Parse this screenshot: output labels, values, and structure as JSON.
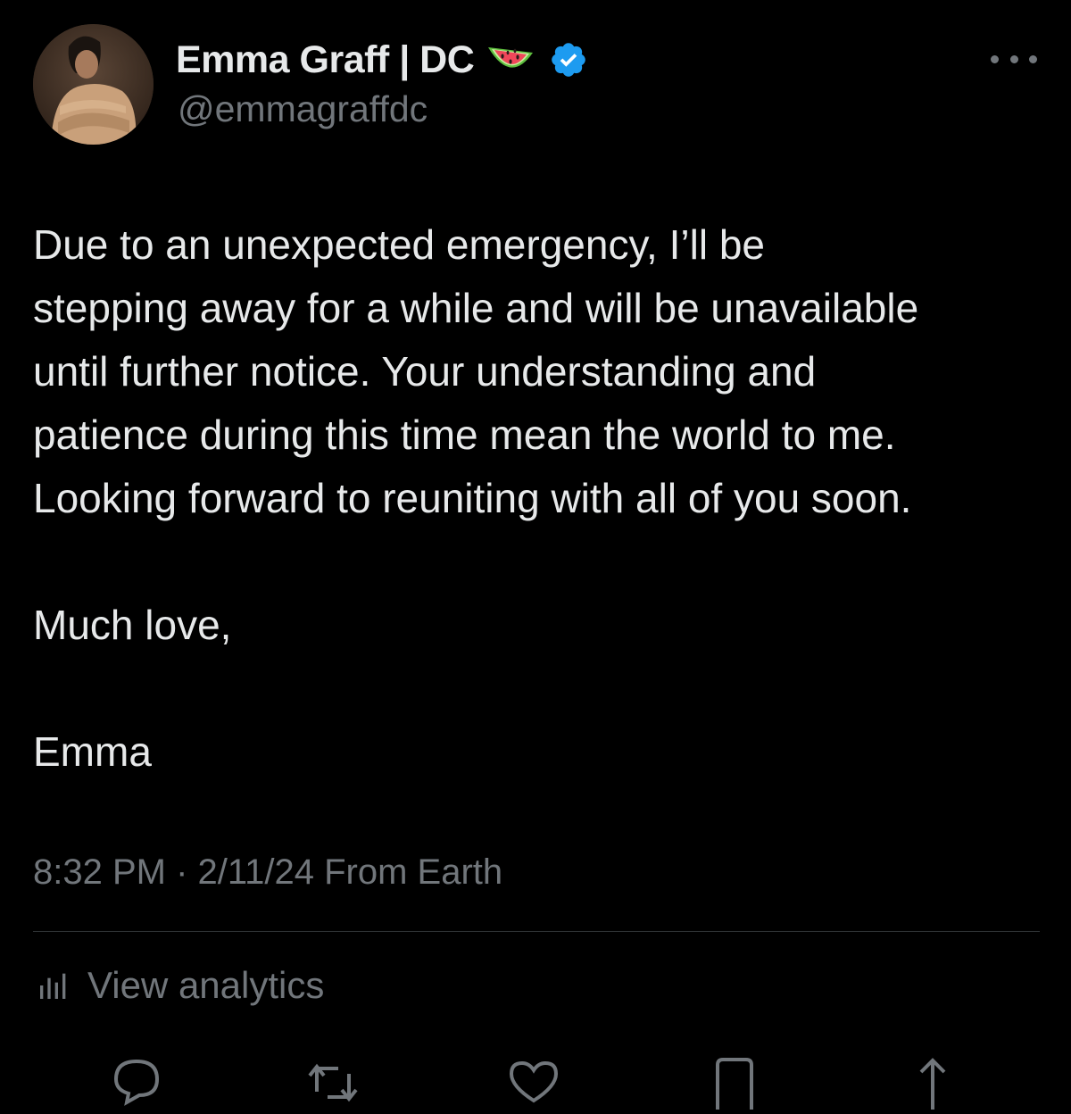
{
  "tweet": {
    "author": {
      "display_name": "Emma Graff | DC",
      "handle": "@emmagraffdc",
      "name_emoji": "watermelon-icon",
      "verified": true,
      "verified_color": "#1d9bf0"
    },
    "text_lines": [
      "Due to an unexpected emergency, I’ll be",
      "stepping away for a while and will be unavailable",
      "until further notice. Your understanding and",
      "patience during this time mean the world to me.",
      "Looking forward to reuniting with all of you soon."
    ],
    "sign_off": "Much love,",
    "signature": "Emma",
    "timestamp": "8:32 PM · 2/11/24 From Earth",
    "analytics_label": "View analytics",
    "actions": [
      "reply-icon",
      "retweet-icon",
      "like-icon",
      "bookmark-icon",
      "share-icon"
    ]
  },
  "colors": {
    "background": "#000000",
    "primary_text": "#e7e9ea",
    "secondary_text": "#71767b",
    "divider": "#2f3336"
  }
}
